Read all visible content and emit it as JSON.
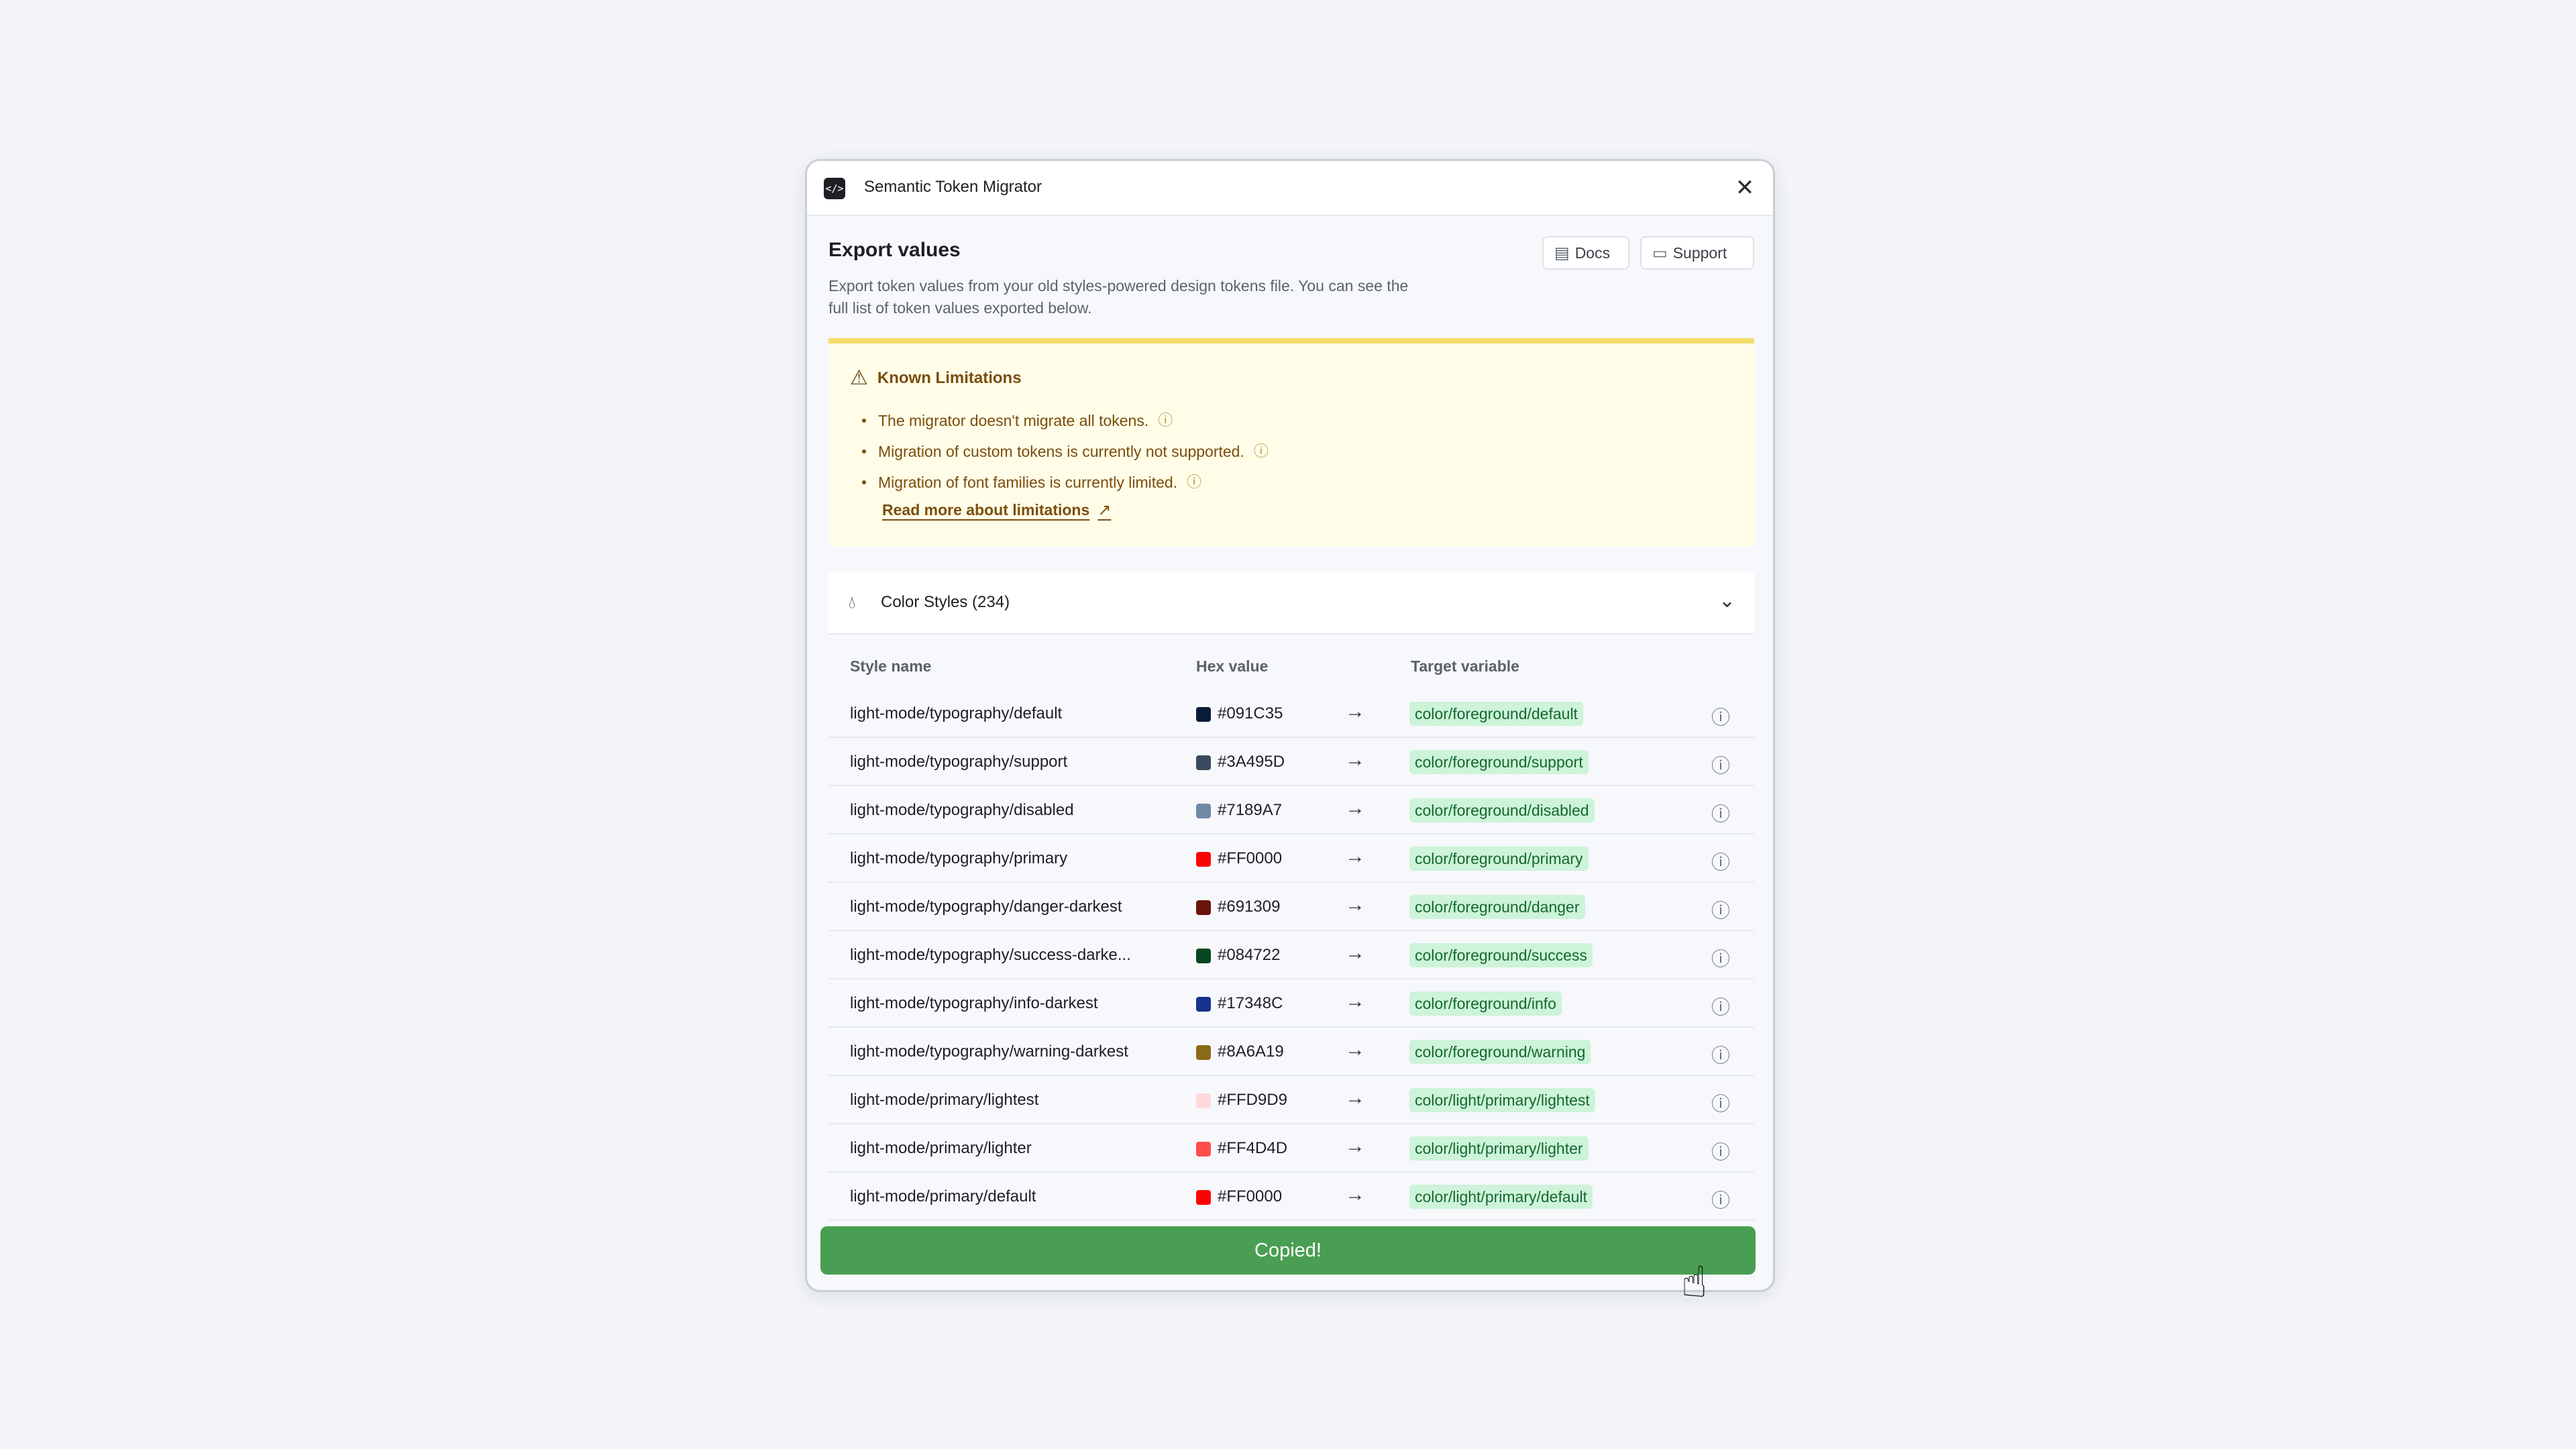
{
  "app": {
    "title": "Semantic Token Migrator",
    "icon": "code-icon"
  },
  "header": {
    "title": "Export values",
    "description": "Export token values from your old styles-powered design tokens file. You can see the full list of token values exported below.",
    "docs_label": "Docs",
    "support_label": "Support"
  },
  "warning": {
    "title": "Known Limitations",
    "items": [
      "The migrator doesn't migrate all tokens.",
      "Migration of custom tokens is currently not supported.",
      "Migration of font families is currently limited."
    ],
    "link_label": "Read more about limitations"
  },
  "section": {
    "label": "Color Styles (234)"
  },
  "table": {
    "headers": {
      "name": "Style name",
      "hex": "Hex value",
      "target": "Target variable"
    },
    "rows": [
      {
        "name": "light-mode/typography/default",
        "hex": "#091C35",
        "color": "#091C35",
        "target": "color/foreground/default"
      },
      {
        "name": "light-mode/typography/support",
        "hex": "#3A495D",
        "color": "#3A495D",
        "target": "color/foreground/support"
      },
      {
        "name": "light-mode/typography/disabled",
        "hex": "#7189A7",
        "color": "#7189A7",
        "target": "color/foreground/disabled"
      },
      {
        "name": "light-mode/typography/primary",
        "hex": "#FF0000",
        "color": "#FF0000",
        "target": "color/foreground/primary"
      },
      {
        "name": "light-mode/typography/danger-darkest",
        "hex": "#691309",
        "color": "#691309",
        "target": "color/foreground/danger"
      },
      {
        "name": "light-mode/typography/success-darke...",
        "hex": "#084722",
        "color": "#084722",
        "target": "color/foreground/success"
      },
      {
        "name": "light-mode/typography/info-darkest",
        "hex": "#17348C",
        "color": "#17348C",
        "target": "color/foreground/info"
      },
      {
        "name": "light-mode/typography/warning-darkest",
        "hex": "#8A6A19",
        "color": "#8A6A19",
        "target": "color/foreground/warning"
      },
      {
        "name": "light-mode/primary/lightest",
        "hex": "#FFD9D9",
        "color": "#FFD9D9",
        "target": "color/light/primary/lightest"
      },
      {
        "name": "light-mode/primary/lighter",
        "hex": "#FF4D4D",
        "color": "#FF4D4D",
        "target": "color/light/primary/lighter"
      },
      {
        "name": "light-mode/primary/default",
        "hex": "#FF0000",
        "color": "#FF0000",
        "target": "color/light/primary/default"
      }
    ]
  },
  "toast": {
    "label": "Copied!"
  },
  "colors": {
    "success": "#4A9E53",
    "tag_bg": "#CDF3D9",
    "tag_text": "#14682F",
    "warning_bg": "#FFFDE8",
    "warning_border": "#F4DD6A"
  }
}
